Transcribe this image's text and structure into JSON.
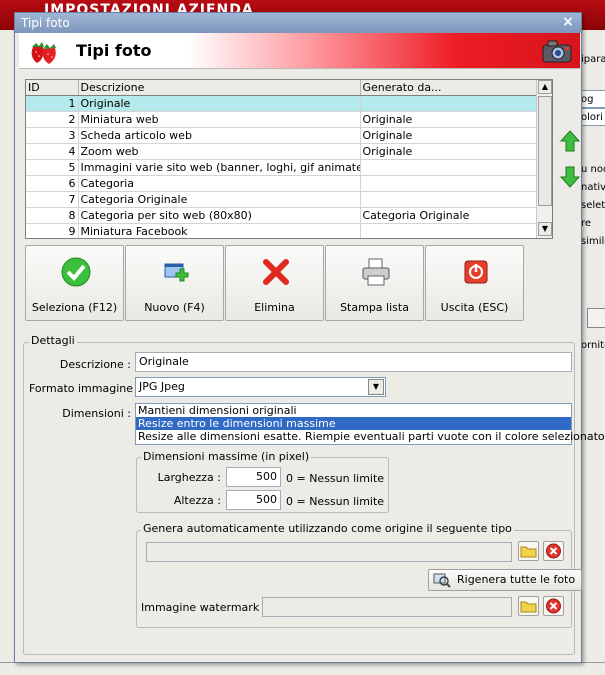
{
  "background": {
    "app_title": "IMPOSTAZIONI AZIENDA",
    "right_fragments": [
      "ipara",
      "og",
      "olori",
      "u nod",
      "nativo",
      "selet",
      "re",
      "simile",
      "ornito"
    ]
  },
  "window": {
    "title": "Tipi foto",
    "close_symbol": "×",
    "header_title": "Tipi foto"
  },
  "grid": {
    "columns": [
      "ID",
      "Descrizione",
      "Generato da..."
    ],
    "rows": [
      {
        "id": "1",
        "descrizione": "Originale",
        "generato": ""
      },
      {
        "id": "2",
        "descrizione": "Miniatura web",
        "generato": "Originale"
      },
      {
        "id": "3",
        "descrizione": "Scheda articolo web",
        "generato": "Originale"
      },
      {
        "id": "4",
        "descrizione": "Zoom web",
        "generato": "Originale"
      },
      {
        "id": "5",
        "descrizione": "Immagini varie sito web (banner, loghi, gif animate, fla...",
        "generato": ""
      },
      {
        "id": "6",
        "descrizione": "Categoria",
        "generato": ""
      },
      {
        "id": "7",
        "descrizione": "Categoria Originale",
        "generato": ""
      },
      {
        "id": "8",
        "descrizione": "Categoria per sito web (80x80)",
        "generato": "Categoria Originale"
      },
      {
        "id": "9",
        "descrizione": "Miniatura Facebook",
        "generato": ""
      }
    ],
    "selected_index": 0
  },
  "toolbar": {
    "seleziona": "Seleziona (F12)",
    "nuovo": "Nuovo (F4)",
    "elimina": "Elimina",
    "stampa": "Stampa lista",
    "uscita": "Uscita (ESC)"
  },
  "details": {
    "group_label": "Dettagli",
    "descrizione_label": "Descrizione :",
    "descrizione_value": "Originale",
    "formato_label": "Formato immagine :",
    "formato_value": "JPG Jpeg",
    "dimensioni_label": "Dimensioni :",
    "dimensioni_options": [
      "Mantieni dimensioni originali",
      "Resize entro le dimensioni massime",
      "Resize alle dimensioni esatte. Riempie eventuali parti vuote con il colore selezionato."
    ],
    "dimensioni_selected": 1,
    "max_group_label": "Dimensioni massime (in pixel)",
    "larghezza_label": "Larghezza :",
    "larghezza_value": "500",
    "altezza_label": "Altezza :",
    "altezza_value": "500",
    "nessun_limite": "0 = Nessun limite",
    "genera_group_label": "Genera automaticamente utilizzando come origine il seguente tipo",
    "genera_value": "",
    "rigenera_label": "Rigenera tutte le foto",
    "watermark_label": "Immagine watermark :",
    "watermark_value": ""
  },
  "colors": {
    "selection_row": "#b4eaec",
    "list_selection": "#316ac5",
    "banner_red": "#ee1c24",
    "titlebar": "#8aa2c6"
  }
}
